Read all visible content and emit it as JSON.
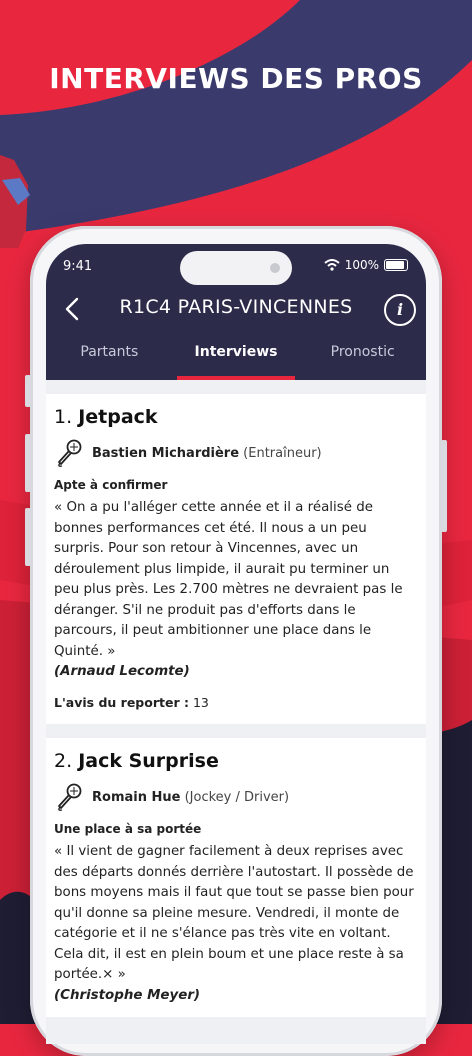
{
  "promo": {
    "title": "INTERVIEWS DES PROS"
  },
  "status_bar": {
    "time": "9:41",
    "battery": "100%"
  },
  "header": {
    "title": "R1C4 PARIS-VINCENNES",
    "info_label": "i"
  },
  "tabs": [
    {
      "label": "Partants",
      "active": false
    },
    {
      "label": "Interviews",
      "active": true
    },
    {
      "label": "Pronostic",
      "active": false
    }
  ],
  "interviews": [
    {
      "number": "1.",
      "horse": "Jetpack",
      "person_name": "Bastien Michardière",
      "person_role": "(Entraîneur)",
      "subtitle": "Apte à confirmer",
      "quote": "« On a pu l'alléger cette année et il a réalisé de bonnes performances cet été. Il nous a un peu surpris. Pour son retour à Vincennes, avec un déroulement plus limpide, il aurait pu terminer un peu plus près. Les 2.700 mètres ne devraient pas le déranger. S'il ne produit pas d'efforts dans le parcours, il peut ambitionner une place dans le Quinté. »",
      "author": "(Arnaud Lecomte)",
      "avis_label": "L'avis du reporter :",
      "avis_value": "13"
    },
    {
      "number": "2.",
      "horse": "Jack Surprise",
      "person_name": "Romain Hue",
      "person_role": "(Jockey / Driver)",
      "subtitle": "Une place à sa portée",
      "quote": "« Il vient de gagner facilement à deux reprises avec des départs donnés derrière l'autostart. Il possède de bons moyens mais il faut que tout se passe bien pour qu'il donne sa pleine mesure. Vendredi, il monte de catégorie et il ne s'élance pas très vite en voltant. Cela dit, il est en plein boum et une place reste à sa portée.× »",
      "author": "(Christophe Meyer)"
    }
  ],
  "colors": {
    "brand_red": "#e8273f",
    "header_navy": "#2c2b4a",
    "bg_navy": "#3a3b6e"
  }
}
